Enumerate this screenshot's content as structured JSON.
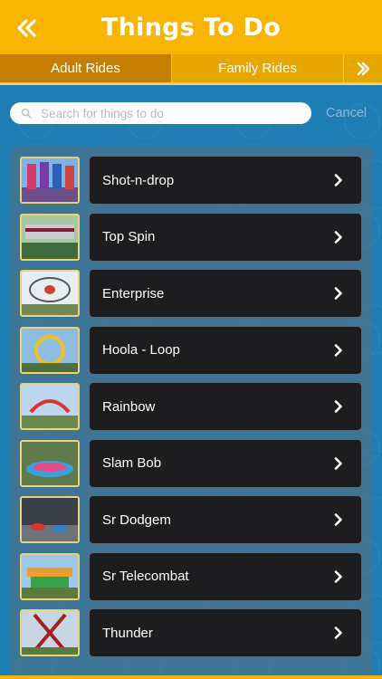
{
  "header": {
    "title": "Things To Do",
    "back_icon": "double-chevron-left-icon"
  },
  "tabs": [
    {
      "label": "Adult Rides",
      "active": true
    },
    {
      "label": "Family Rides",
      "active": false
    }
  ],
  "tabs_next_icon": "double-chevron-right-icon",
  "search": {
    "placeholder": "Search for things to do",
    "value": "",
    "cancel_label": "Cancel"
  },
  "items": [
    {
      "label": "Shot-n-drop"
    },
    {
      "label": "Top Spin"
    },
    {
      "label": "Enterprise"
    },
    {
      "label": "Hoola - Loop"
    },
    {
      "label": "Rainbow"
    },
    {
      "label": "Slam Bob"
    },
    {
      "label": "Sr Dodgem"
    },
    {
      "label": "Sr Telecombat"
    },
    {
      "label": "Thunder"
    }
  ],
  "colors": {
    "header": "#f7b400",
    "tab_active": "#c57f00",
    "background": "#1e7db2",
    "item_bg": "#1d1d1f"
  }
}
